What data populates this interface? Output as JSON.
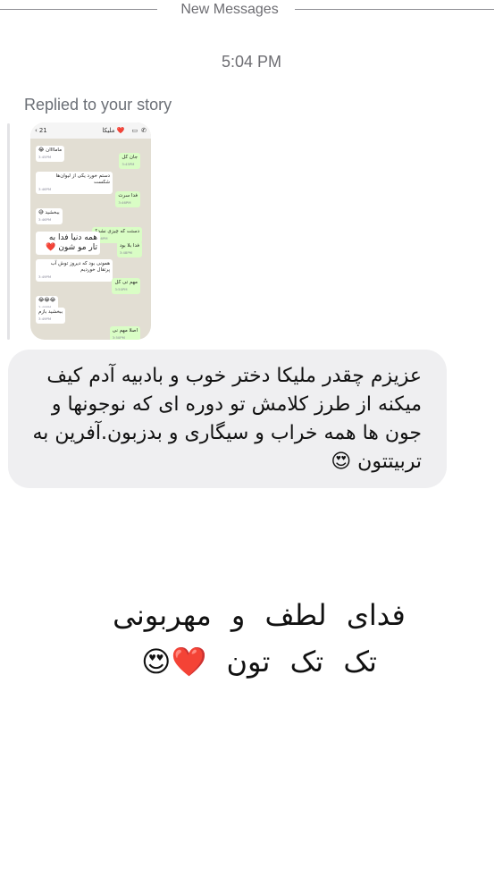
{
  "divider": {
    "label": "New Messages"
  },
  "timestamp": "5:04 PM",
  "story_reply": {
    "label": "Replied to your story",
    "story": {
      "header_back": "21",
      "contact_name": "ملیکا ❤️",
      "messages": [
        {
          "dir": "in",
          "text": "ماماااان 😂",
          "time": "3:45PM"
        },
        {
          "dir": "out",
          "text": "جان کل",
          "time": "3:45PM"
        },
        {
          "dir": "in",
          "text": "دستم خورد یکی از لیوان‌ها شکست",
          "time": "3:46PM"
        },
        {
          "dir": "out",
          "text": "فدا سرت",
          "time": "3:46PM"
        },
        {
          "dir": "in",
          "text": "ببخشید 😅",
          "time": "3:46PM"
        },
        {
          "dir": "out",
          "text": "دستت که چیزی نشد؟",
          "time": "3:46PM"
        },
        {
          "dir": "out",
          "text": "فدا بلا بود",
          "time": "3:48PM"
        },
        {
          "dir": "in",
          "text": "همه دنیا فدا به تار مو شون ❤️",
          "time": ""
        },
        {
          "dir": "in",
          "text": "همونی بود که دیروز توش آب پرتقال خوردیم",
          "time": "3:49PM"
        },
        {
          "dir": "out",
          "text": "مهم تی کل",
          "time": "3:50PM"
        },
        {
          "dir": "in",
          "text": "😂😂😂",
          "time": "3:49PM"
        },
        {
          "dir": "in",
          "text": "ببخشید بازم",
          "time": "3:49PM"
        },
        {
          "dir": "out",
          "text": "اصلا مهم نی",
          "time": "3:50PM"
        }
      ]
    },
    "message": "عزیزم چقدر ملیکا دختر خوب و بادبیه آدم کیف میکنه از طرز کلامش تو دوره ای که نوجونها و جون ها همه خراب و سیگاری و بدزبون.آفرین به تربیتتون 😍"
  },
  "reply": {
    "line1": "فدای لطف و مهربونی",
    "line2": "تک تک تون ❤️😍"
  }
}
